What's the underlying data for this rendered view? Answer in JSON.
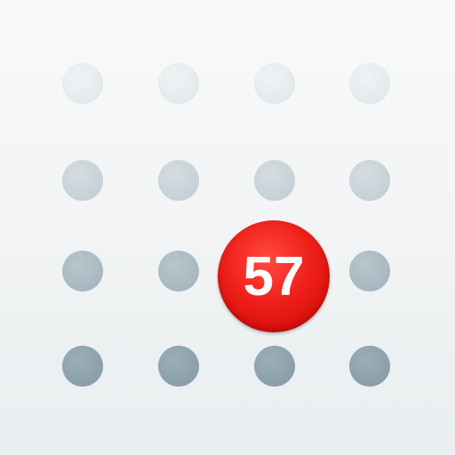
{
  "badge": {
    "count": "57",
    "color": "#e8201a"
  },
  "grid": {
    "rows": 4,
    "columns": 4,
    "dot_colors": [
      "#e4e9ec",
      "#c6d1d6",
      "#a7b8c0",
      "#8aa0a9"
    ]
  },
  "background_color": "#f3f5f6"
}
